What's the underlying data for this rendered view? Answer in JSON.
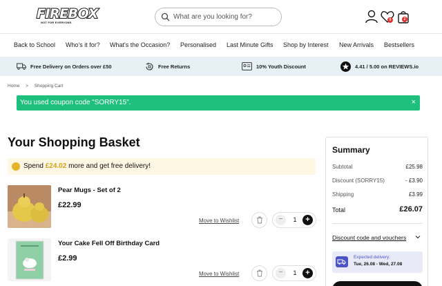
{
  "header": {
    "logo_text": "FIREBOX",
    "logo_tagline": "NOT FOR EVERYONE.",
    "search_placeholder": "What are you looking for?",
    "wishlist_count": "0",
    "basket_count": "2"
  },
  "nav": {
    "items": [
      "Back to School",
      "Who's it for?",
      "What's the Occasion?",
      "Personalised",
      "Last Minute Gifts",
      "Shop by Interest",
      "New Arrivals",
      "Bestsellers"
    ]
  },
  "benefits": [
    {
      "icon": "delivery-truck-icon",
      "text": "Free Delivery on Orders over £50"
    },
    {
      "icon": "returns-icon",
      "text": "Free Returns"
    },
    {
      "icon": "id-card-icon",
      "text": "10% Youth Discount"
    },
    {
      "icon": "star-icon",
      "text": "4.41 / 5.00 on REVIEWS.io"
    }
  ],
  "breadcrumb": {
    "home": "Home",
    "separator": ">",
    "current": "Shopping Cart"
  },
  "coupon_banner": {
    "message": "You used coupon code \"SORRY15\".",
    "close": "×",
    "color": "#1fbf7e"
  },
  "page_title": "Your Shopping Basket",
  "free_delivery": {
    "prefix": "Spend",
    "amount": "£24.02",
    "suffix": "more and get free delivery!"
  },
  "items": [
    {
      "name": "Pear Mugs - Set of 2",
      "price": "£22.99",
      "wishlist_label": "Move to Wishlist",
      "quantity": "1"
    },
    {
      "name": "Your Cake Fell Off Birthday Card",
      "price": "£2.99",
      "wishlist_label": "Move to Wishlist",
      "quantity": "1"
    }
  ],
  "quantity_controls": {
    "minus": "−",
    "plus": "+"
  },
  "summary": {
    "title": "Summary",
    "subtotal_label": "Subtotal",
    "subtotal_value": "£25.98",
    "discount_label": "Discount (SORRY15)",
    "discount_value": "- £3.90",
    "shipping_label": "Shipping",
    "shipping_value": "£3.99",
    "total_label": "Total",
    "total_value": "£26.07",
    "discount_toggle": "Discount code and vouchers",
    "delivery_label": "Expected delivery:",
    "delivery_dates": "Tue, 26.08 - Wed, 27.08"
  },
  "colors": {
    "accent_green": "#1fbf7e",
    "benefit_bar": "#e7f1f5",
    "gold": "#d4a21b",
    "delivery_blue": "#4b54c7",
    "badge_red": "#e0312b"
  }
}
